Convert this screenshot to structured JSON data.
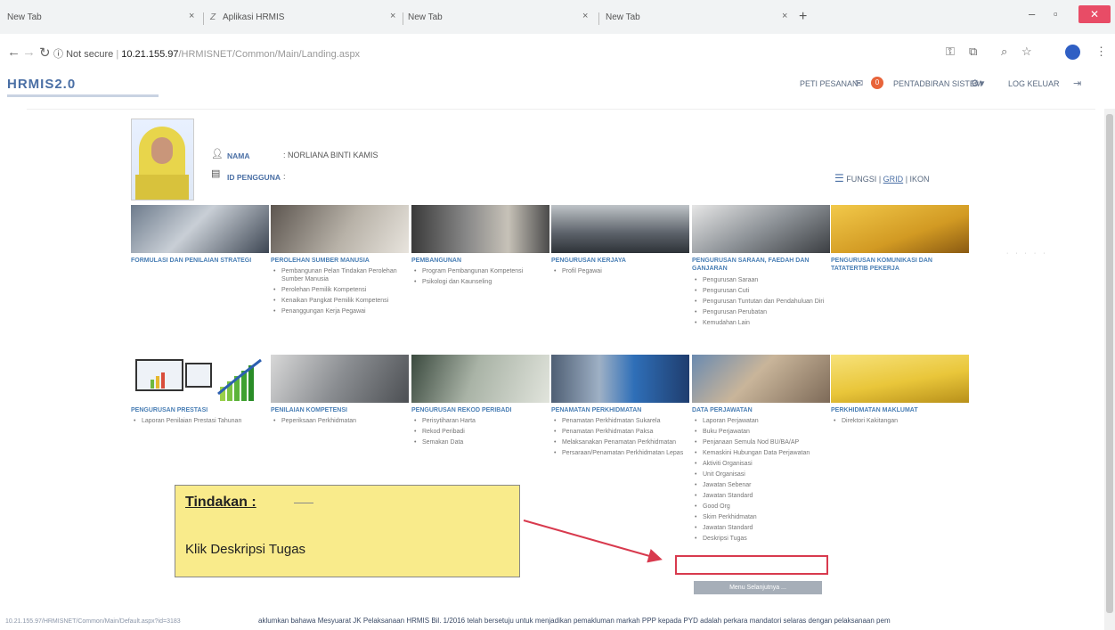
{
  "browser": {
    "tabs": [
      {
        "label": "New Tab"
      },
      {
        "label": "Aplikasi HRMIS"
      },
      {
        "label": "New Tab"
      },
      {
        "label": "New Tab"
      }
    ],
    "close_glyph": "×",
    "new_tab_glyph": "+",
    "url": {
      "security": "Not secure",
      "host": "10.21.155.97",
      "path": "/HRMISNET/Common/Main/Landing.aspx"
    }
  },
  "app": {
    "logo": "HRMIS2.0",
    "header": {
      "inbox_label": "PETI PESANAN",
      "inbox_badge": "0",
      "admin_label": "PENTADBIRAN SISTEM",
      "logout_label": "LOG KELUAR"
    },
    "user": {
      "name_label": "NAMA",
      "name_value": ": NORLIANA BINTI KAMIS",
      "id_label": "ID PENGGUNA",
      "id_value": ":"
    },
    "view_switch": {
      "fungsi": "FUNGSI",
      "sep": "|",
      "grid": "GRID",
      "ikon": "IKON"
    },
    "modules_row1": [
      {
        "title": "FORMULASI DAN PENILAIAN STRATEGI",
        "items": []
      },
      {
        "title": "PEROLEHAN SUMBER MANUSIA",
        "items": [
          "Pembangunan Pelan Tindakan Perolehan Sumber Manusia",
          "Perolehan Pemilik Kompetensi",
          "Kenaikan Pangkat Pemilik Kompetensi",
          "Penanggungan Kerja Pegawai"
        ]
      },
      {
        "title": "PEMBANGUNAN",
        "items": [
          "Program Pembangunan Kompetensi",
          "Psikologi dan Kaunseling"
        ]
      },
      {
        "title": "PENGURUSAN KERJAYA",
        "items": [
          "Profil Pegawai"
        ]
      },
      {
        "title": "PENGURUSAN SARAAN, FAEDAH DAN GANJARAN",
        "items": [
          "Pengurusan Saraan",
          "Pengurusan Cuti",
          "Pengurusan Tuntutan dan Pendahuluan Diri",
          "Pengurusan Perubatan",
          "Kemudahan Lain"
        ]
      },
      {
        "title": "PENGURUSAN KOMUNIKASI DAN TATATERTIB PEKERJA",
        "items": []
      }
    ],
    "modules_row2": [
      {
        "title": "PENGURUSAN PRESTASI",
        "items": [
          "Laporan Penilaian Prestasi Tahunan"
        ]
      },
      {
        "title": "PENILAIAN KOMPETENSI",
        "items": [
          "Peperiksaan Perkhidmatan"
        ]
      },
      {
        "title": "PENGURUSAN REKOD PERIBADI",
        "items": [
          "Perisytiharan Harta",
          "Rekod Peribadi",
          "Semakan Data"
        ]
      },
      {
        "title": "PENAMATAN PERKHIDMATAN",
        "items": [
          "Penamatan Perkhidmatan Sukarela",
          "Penamatan Perkhidmatan Paksa",
          "Melaksanakan Penamatan Perkhidmatan",
          "Persaraan/Penamatan Perkhidmatan Lepas"
        ]
      },
      {
        "title": "DATA PERJAWATAN",
        "items": [
          "Laporan Perjawatan",
          "Buku Perjawatan",
          "Penjanaan Semula Nod BU/BA/AP",
          "Kemaskini Hubungan Data Perjawatan",
          "Aktiviti Organisasi",
          "Unit Organisasi",
          "Jawatan Sebenar",
          "Jawatan Standard",
          "Good Org",
          "Skim Perkhidmatan",
          "Jawatan Standard",
          "Deskripsi Tugas"
        ]
      },
      {
        "title": "PERKHIDMATAN MAKLUMAT",
        "items": [
          "Direktori Kakitangan"
        ]
      }
    ],
    "more_button": "Menu Selanjutnya ...",
    "callout": {
      "title": "Tindakan :",
      "body": "Klik Deskripsi Tugas"
    },
    "status_url": "10.21.155.97/HRMISNET/Common/Main/Default.aspx?id=3183",
    "ticker": "aklumkan bahawa Mesyuarat JK Pelaksanaan HRMIS Bil. 1/2016 telah bersetuju untuk menjadikan pemakluman markah PPP kepada PYD adalah perkara mandatori selaras dengan pelaksanaan pem"
  },
  "colors": {
    "accent": "#4a7fb5",
    "callout_bg": "#f9eb8b",
    "highlight": "#d83a4e",
    "badge": "#e8643a"
  }
}
